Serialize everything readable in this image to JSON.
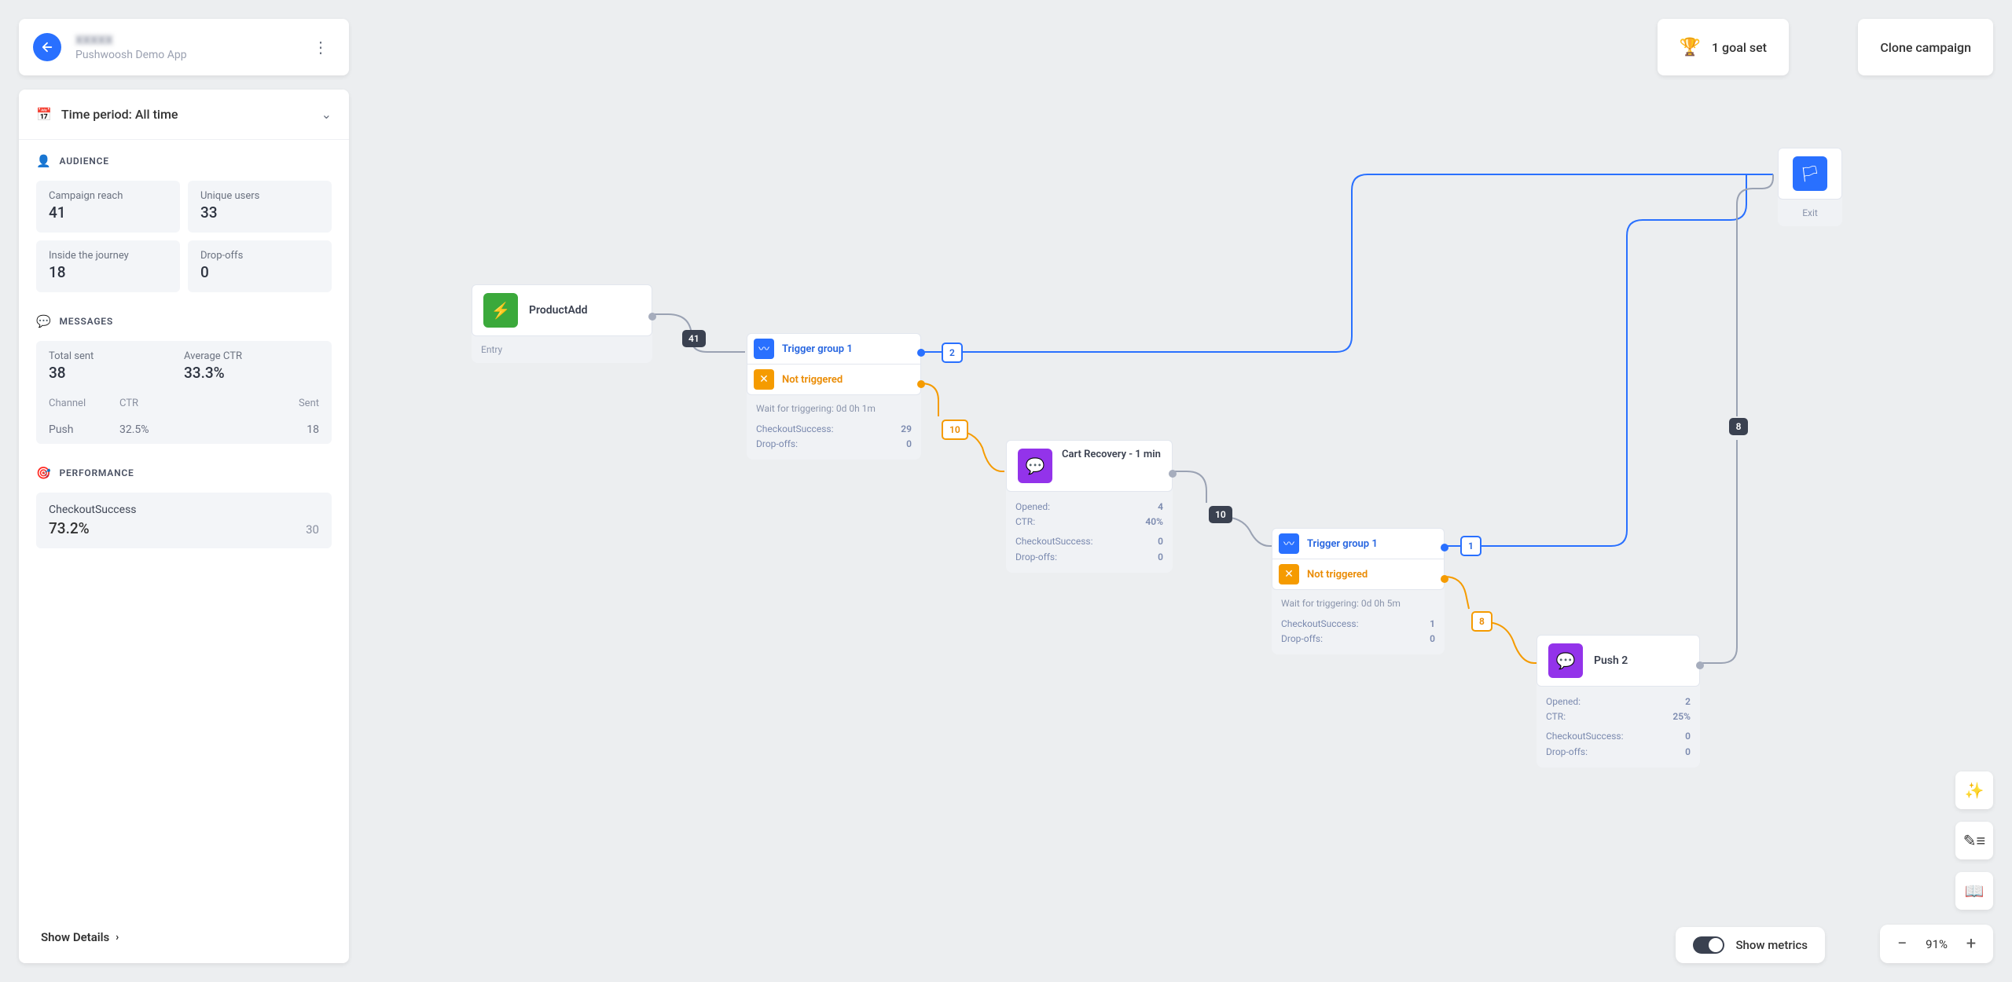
{
  "header": {
    "app_name_main": "XXXXX",
    "app_name_sub": "Pushwoosh Demo App",
    "goal_text": "1 goal set",
    "clone_text": "Clone campaign"
  },
  "sidebar": {
    "time_period": "Time period: All time",
    "audience_hdr": "AUDIENCE",
    "audience": [
      {
        "label": "Campaign reach",
        "value": "41"
      },
      {
        "label": "Unique users",
        "value": "33"
      },
      {
        "label": "Inside the journey",
        "value": "18"
      },
      {
        "label": "Drop-offs",
        "value": "0"
      }
    ],
    "messages_hdr": "MESSAGES",
    "msgs_totals": [
      {
        "label": "Total sent",
        "value": "38"
      },
      {
        "label": "Average CTR",
        "value": "33.3%"
      }
    ],
    "msg_cols": {
      "channel": "Channel",
      "ctr": "CTR",
      "sent": "Sent"
    },
    "msg_rows": [
      {
        "channel": "Push",
        "ctr": "32.5%",
        "sent": "18"
      }
    ],
    "performance_hdr": "PERFORMANCE",
    "perf": {
      "label": "CheckoutSuccess",
      "pct": "73.2%",
      "n": "30"
    },
    "show_details": "Show Details"
  },
  "nodes": {
    "entry": {
      "title": "ProductAdd",
      "foot": "Entry"
    },
    "tg1": {
      "triggered": "Trigger group 1",
      "not": "Not triggered",
      "wait": "Wait for triggering: 0d 0h 1m",
      "s1": "CheckoutSuccess:",
      "s1v": "29",
      "s2": "Drop-offs:",
      "s2v": "0"
    },
    "cart": {
      "title": "Cart Recovery - 1 min",
      "opened": "Opened:",
      "openedv": "4",
      "ctr": "CTR:",
      "ctrv": "40%",
      "cs": "CheckoutSuccess:",
      "csv": "0",
      "do": "Drop-offs:",
      "dov": "0"
    },
    "tg2": {
      "triggered": "Trigger group 1",
      "not": "Not triggered",
      "wait": "Wait for triggering: 0d 0h 5m",
      "s1": "CheckoutSuccess:",
      "s1v": "1",
      "s2": "Drop-offs:",
      "s2v": "0"
    },
    "push2": {
      "title": "Push 2",
      "opened": "Opened:",
      "openedv": "2",
      "ctr": "CTR:",
      "ctrv": "25%",
      "cs": "CheckoutSuccess:",
      "csv": "0",
      "do": "Drop-offs:",
      "dov": "0"
    },
    "exit": {
      "foot": "Exit"
    }
  },
  "badges": {
    "b41": "41",
    "b2": "2",
    "b10a": "10",
    "b10b": "10",
    "b1": "1",
    "b8a": "8",
    "b8b": "8"
  },
  "bottom": {
    "show_metrics": "Show metrics",
    "zoom": "91%"
  }
}
